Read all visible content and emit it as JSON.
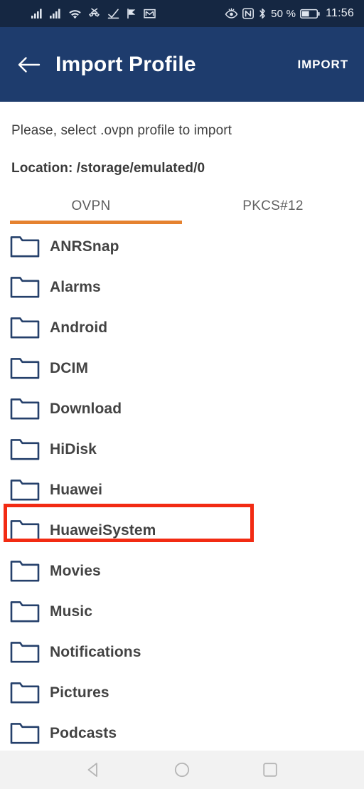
{
  "status_bar": {
    "left_icons": [
      {
        "name": "signal-bars-sim1-icon"
      },
      {
        "name": "signal-bars-sim2-icon"
      },
      {
        "name": "wifi-icon"
      },
      {
        "name": "missed-call-icon"
      },
      {
        "name": "download-complete-icon"
      },
      {
        "name": "flag-icon"
      },
      {
        "name": "gmail-icon"
      }
    ],
    "right_icons": [
      {
        "name": "eye-comfort-icon"
      },
      {
        "name": "nfc-icon"
      },
      {
        "name": "bluetooth-icon"
      },
      {
        "name": "battery-icon"
      }
    ],
    "battery_percent": "50 %",
    "clock": "11:56",
    "background": "#152742"
  },
  "app_bar": {
    "back_icon": "back-arrow-icon",
    "title": "Import Profile",
    "action_label": "IMPORT",
    "background": "#1e3c6d"
  },
  "content": {
    "instruction": "Please, select .ovpn profile to import",
    "location": "Location: /storage/emulated/0"
  },
  "tabs": {
    "items": [
      {
        "label": "OVPN",
        "selected": true
      },
      {
        "label": "PKCS#12",
        "selected": false
      }
    ],
    "indicator_color": "#e5822f"
  },
  "file_list": {
    "folder_icon": "folder-icon",
    "items": [
      {
        "name": "ANRSnap",
        "highlighted": false
      },
      {
        "name": "Alarms",
        "highlighted": false
      },
      {
        "name": "Android",
        "highlighted": false
      },
      {
        "name": "DCIM",
        "highlighted": false
      },
      {
        "name": "Download",
        "highlighted": true
      },
      {
        "name": "HiDisk",
        "highlighted": false
      },
      {
        "name": "Huawei",
        "highlighted": false
      },
      {
        "name": "HuaweiSystem",
        "highlighted": false
      },
      {
        "name": "Movies",
        "highlighted": false
      },
      {
        "name": "Music",
        "highlighted": false
      },
      {
        "name": "Notifications",
        "highlighted": false
      },
      {
        "name": "Pictures",
        "highlighted": false
      },
      {
        "name": "Podcasts",
        "highlighted": false
      }
    ]
  },
  "annotation": {
    "target": "Download",
    "color": "#f22b13"
  },
  "nav_bar": {
    "buttons": [
      {
        "name": "nav-back-button"
      },
      {
        "name": "nav-home-button"
      },
      {
        "name": "nav-recents-button"
      }
    ],
    "background": "#f2f2f2"
  }
}
